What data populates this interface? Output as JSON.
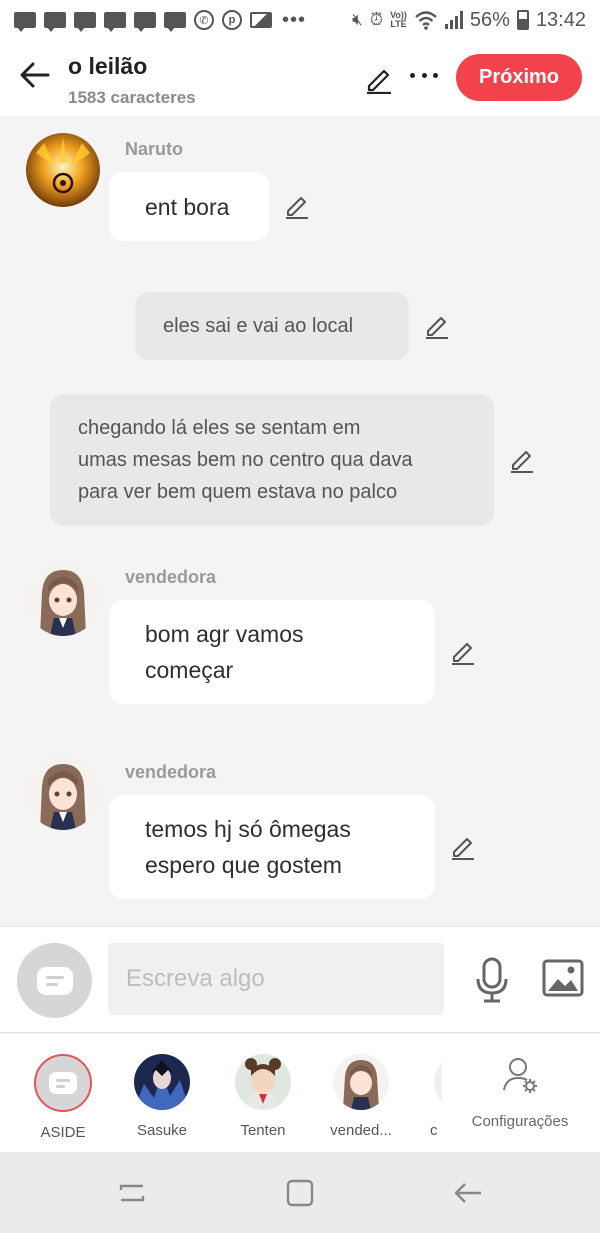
{
  "status_bar": {
    "battery": "56%",
    "time": "13:42",
    "network": "LTE",
    "volte": "Vo))"
  },
  "header": {
    "title": "o leilão",
    "subtitle": "1583 caracteres",
    "next_label": "Próximo"
  },
  "messages": [
    {
      "type": "character",
      "sender": "Naruto",
      "lines": [
        "ent bora"
      ]
    },
    {
      "type": "narration",
      "lines": [
        "eles sai e vai ao local"
      ]
    },
    {
      "type": "narration",
      "lines": [
        "chegando lá eles se sentam em",
        "umas mesas bem no centro qua dava",
        "para ver bem quem estava no palco"
      ]
    },
    {
      "type": "character",
      "sender": "vendedora",
      "lines": [
        "bom agr vamos",
        "começar"
      ]
    },
    {
      "type": "character",
      "sender": "vendedora",
      "lines": [
        "temos hj só ômegas",
        "espero que gostem"
      ]
    }
  ],
  "input": {
    "placeholder": "Escreva algo"
  },
  "characters": [
    {
      "name": "ASIDE"
    },
    {
      "name": "Sasuke"
    },
    {
      "name": "Tenten"
    },
    {
      "name": "vended..."
    },
    {
      "name": "c"
    }
  ],
  "settings_label": "Configurações",
  "colors": {
    "accent": "#f2434d",
    "bubble": "#ffffff",
    "narration_bubble": "#e8e8e8",
    "background": "#f4f4f4"
  }
}
